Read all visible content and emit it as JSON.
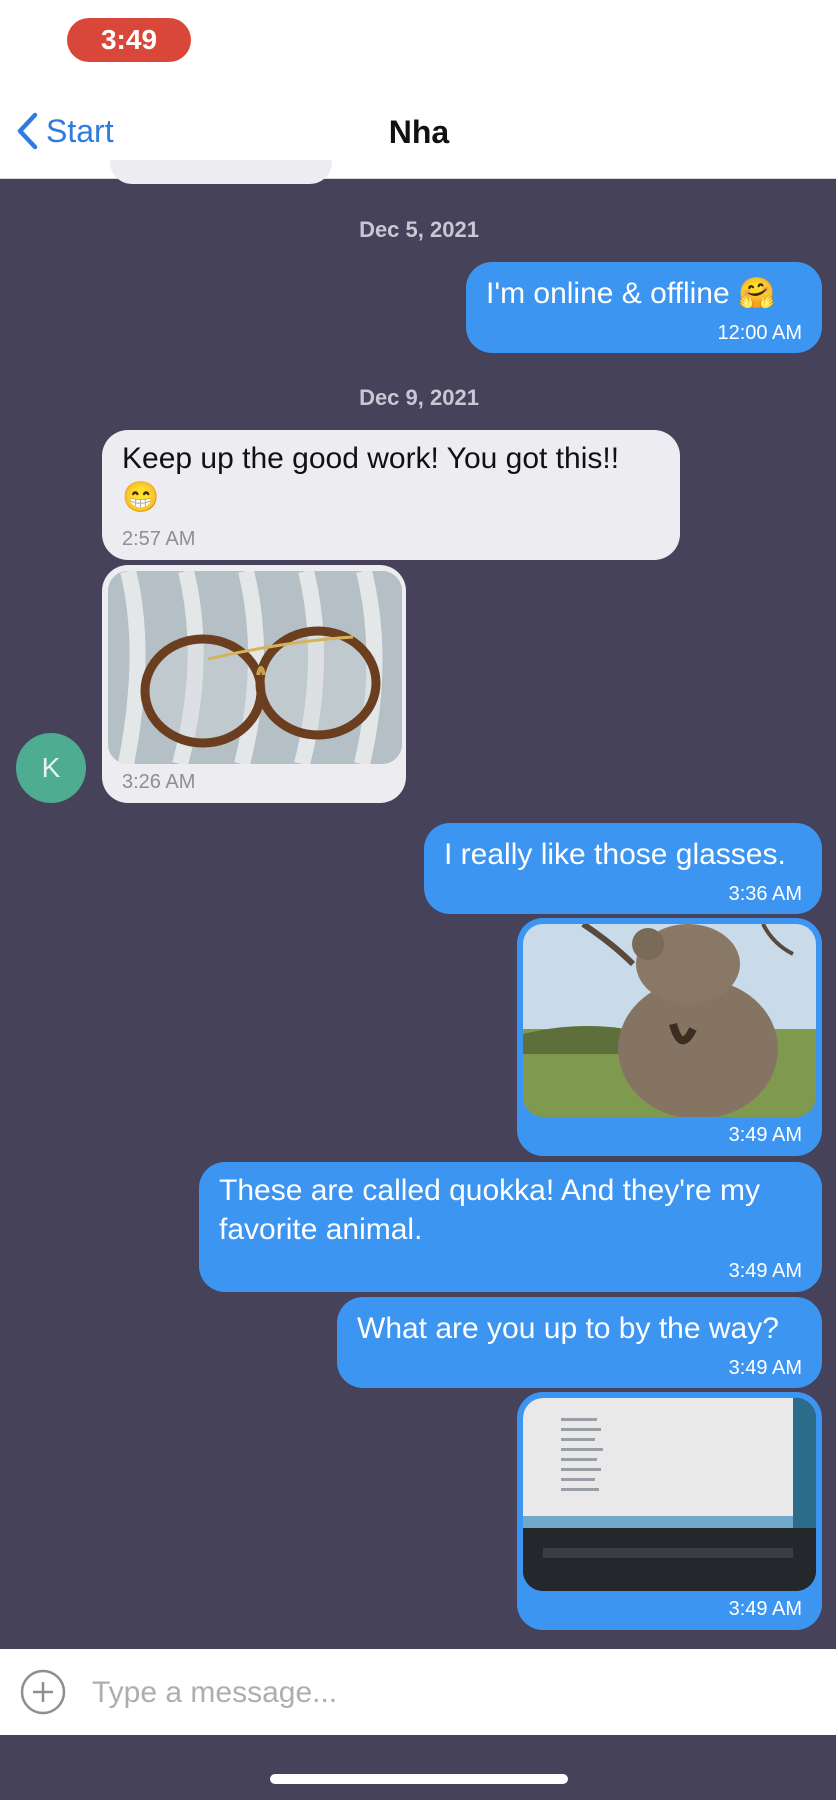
{
  "status": {
    "time": "3:49"
  },
  "nav": {
    "back_label": "Start",
    "title": "Nha"
  },
  "dates": [
    "Dec 5, 2021",
    "Dec 9, 2021"
  ],
  "messages": {
    "m1": {
      "text": "I'm online & offline 🤗",
      "time": "12:00 AM"
    },
    "m2": {
      "text": "Keep up the good work! You got this!! 😁",
      "time": "2:57 AM"
    },
    "m3": {
      "time": "3:26 AM"
    },
    "m4": {
      "text": "I really like those glasses.",
      "time": "3:36 AM"
    },
    "m5": {
      "time": "3:49 AM"
    },
    "m6": {
      "text": "These are called quokka! And they're my favorite animal.",
      "time": "3:49 AM"
    },
    "m7": {
      "text": "What are you up to by the way?",
      "time": "3:49 AM"
    },
    "m8": {
      "time": "3:49 AM"
    }
  },
  "avatar": {
    "initial": "K"
  },
  "composer": {
    "placeholder": "Type a message..."
  },
  "colors": {
    "outgoing": "#3d95f2",
    "incoming": "#ececf1",
    "background": "#46425a",
    "accent": "#2f7be0",
    "avatar": "#4ead91"
  }
}
